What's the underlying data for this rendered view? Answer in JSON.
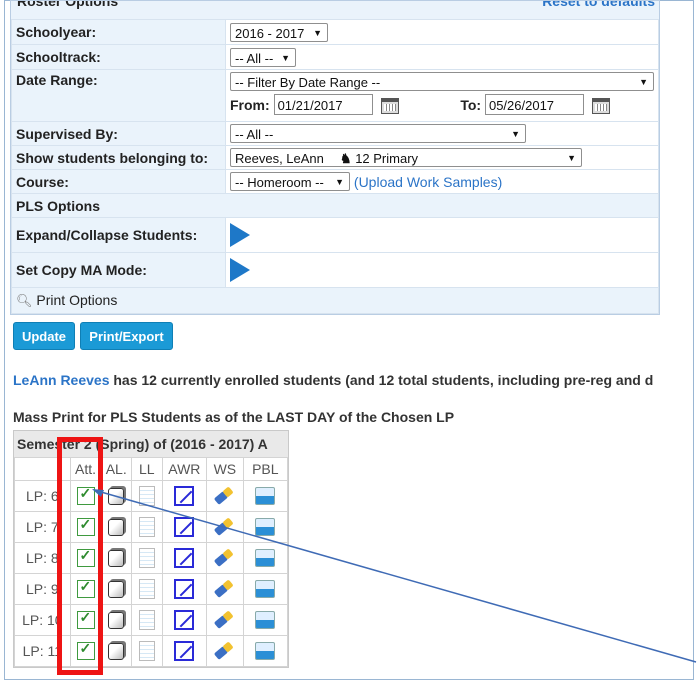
{
  "roster": {
    "title": "Roster Options",
    "reset_link": "Reset to defaults",
    "schoolyear": {
      "label": "Schoolyear:",
      "value": "2016 - 2017"
    },
    "schooltrack": {
      "label": "Schooltrack:",
      "value": "-- All --"
    },
    "date_range": {
      "label": "Date Range:",
      "value": "-- Filter By Date Range --",
      "from_label": "From:",
      "from_value": "01/21/2017",
      "to_label": "To:",
      "to_value": "05/26/2017"
    },
    "supervised_by": {
      "label": "Supervised By:",
      "value": "-- All --"
    },
    "show_students": {
      "label": "Show students belonging to:",
      "value": "Reeves, LeAnn",
      "group": "12 Primary"
    },
    "course": {
      "label": "Course:",
      "value": "-- Homeroom --",
      "upload_link": "Upload Work Samples"
    },
    "pls_options": "PLS Options",
    "expand_collapse": "Expand/Collapse Students:",
    "copy_ma_mode": "Set Copy MA Mode:",
    "print_options": "Print Options"
  },
  "buttons": {
    "update": "Update",
    "print_export": "Print/Export"
  },
  "summary": {
    "teacher": "LeAnn Reeves",
    "text": " has 12 currently enrolled students (and 12 total students, including pre-reg and d"
  },
  "mass_print": {
    "title": "Mass Print for PLS Students as of the LAST DAY of the Chosen LP",
    "semester": "Semester 2 (Spring) of (2016 - 2017) A",
    "columns": [
      "Att.",
      "AL.",
      "LL",
      "AWR",
      "WS",
      "PBL"
    ],
    "rows": [
      "LP: 6",
      "LP: 7",
      "LP: 8",
      "LP: 9",
      "LP: 10",
      "LP: 11"
    ]
  },
  "colors": {
    "accent": "#1b9ad6",
    "link": "#2b74c7",
    "highlight": "#ee1414",
    "arrow": "#3f6bb5"
  }
}
